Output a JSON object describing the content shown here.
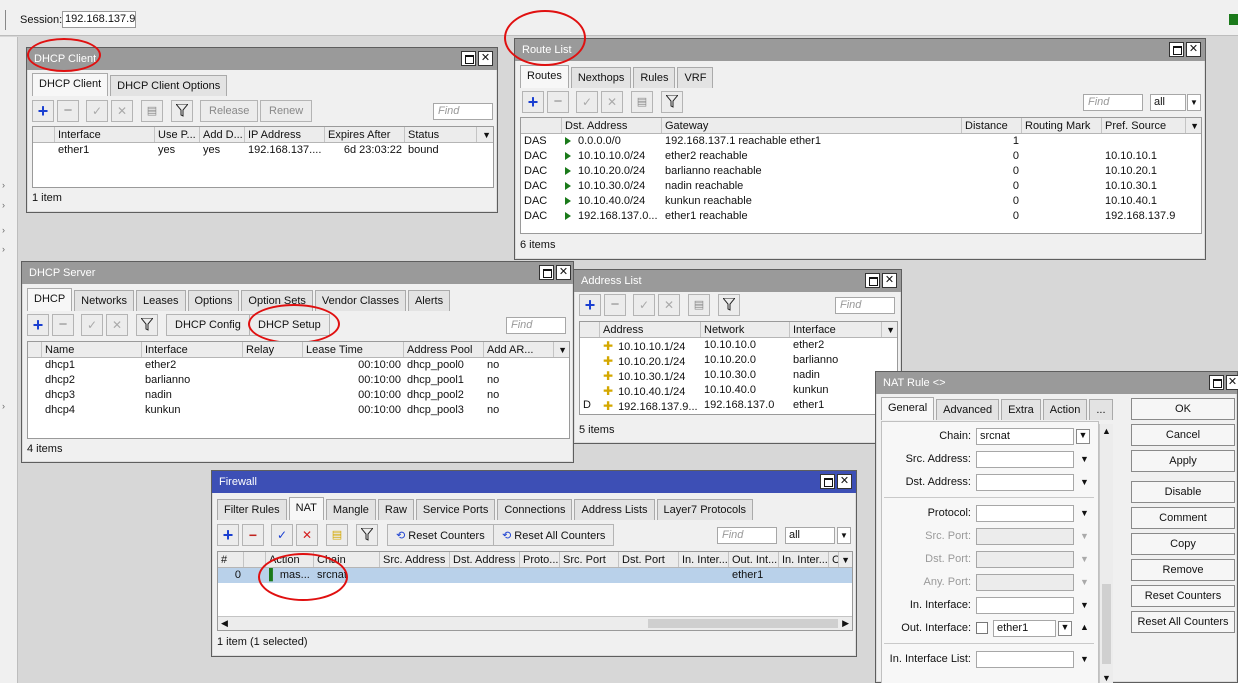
{
  "session": {
    "label": "Session:",
    "value": "192.168.137.9"
  },
  "common": {
    "find": "Find",
    "all": "all"
  },
  "dhcp_client": {
    "title": "DHCP Client",
    "tabs": [
      "DHCP Client",
      "DHCP Client Options"
    ],
    "buttons": {
      "release": "Release",
      "renew": "Renew"
    },
    "columns": [
      "Interface",
      "Use P...",
      "Add D...",
      "IP Address",
      "Expires After",
      "Status"
    ],
    "rows": [
      [
        "ether1",
        "yes",
        "yes",
        "192.168.137....",
        "6d 23:03:22",
        "bound"
      ]
    ],
    "status": "1 item"
  },
  "route_list": {
    "title": "Route List",
    "tabs": [
      "Routes",
      "Nexthops",
      "Rules",
      "VRF"
    ],
    "columns": [
      "Dst. Address",
      "Gateway",
      "Distance",
      "Routing Mark",
      "Pref. Source"
    ],
    "rows": [
      {
        "flag": "DAS",
        "dst": "0.0.0.0/0",
        "gateway": "192.168.137.1 reachable ether1",
        "distance": "1",
        "mark": "",
        "pref": ""
      },
      {
        "flag": "DAC",
        "dst": "10.10.10.0/24",
        "gateway": "ether2 reachable",
        "distance": "0",
        "mark": "",
        "pref": "10.10.10.1"
      },
      {
        "flag": "DAC",
        "dst": "10.10.20.0/24",
        "gateway": "barlianno reachable",
        "distance": "0",
        "mark": "",
        "pref": "10.10.20.1"
      },
      {
        "flag": "DAC",
        "dst": "10.10.30.0/24",
        "gateway": "nadin reachable",
        "distance": "0",
        "mark": "",
        "pref": "10.10.30.1"
      },
      {
        "flag": "DAC",
        "dst": "10.10.40.0/24",
        "gateway": "kunkun reachable",
        "distance": "0",
        "mark": "",
        "pref": "10.10.40.1"
      },
      {
        "flag": "DAC",
        "dst": "192.168.137.0...",
        "gateway": "ether1 reachable",
        "distance": "0",
        "mark": "",
        "pref": "192.168.137.9"
      }
    ],
    "status": "6 items"
  },
  "dhcp_server": {
    "title": "DHCP Server",
    "tabs": [
      "DHCP",
      "Networks",
      "Leases",
      "Options",
      "Option Sets",
      "Vendor Classes",
      "Alerts"
    ],
    "buttons": {
      "config": "DHCP Config",
      "setup": "DHCP Setup"
    },
    "columns": [
      "Name",
      "Interface",
      "Relay",
      "Lease Time",
      "Address Pool",
      "Add AR..."
    ],
    "rows": [
      [
        "dhcp1",
        "ether2",
        "",
        "00:10:00",
        "dhcp_pool0",
        "no"
      ],
      [
        "dhcp2",
        "barlianno",
        "",
        "00:10:00",
        "dhcp_pool1",
        "no"
      ],
      [
        "dhcp3",
        "nadin",
        "",
        "00:10:00",
        "dhcp_pool2",
        "no"
      ],
      [
        "dhcp4",
        "kunkun",
        "",
        "00:10:00",
        "dhcp_pool3",
        "no"
      ]
    ],
    "status": "4 items"
  },
  "address_list": {
    "title": "Address List",
    "columns": [
      "Address",
      "Network",
      "Interface"
    ],
    "rows": [
      {
        "flag": "",
        "address": "10.10.10.1/24",
        "network": "10.10.10.0",
        "interface": "ether2"
      },
      {
        "flag": "",
        "address": "10.10.20.1/24",
        "network": "10.10.20.0",
        "interface": "barlianno"
      },
      {
        "flag": "",
        "address": "10.10.30.1/24",
        "network": "10.10.30.0",
        "interface": "nadin"
      },
      {
        "flag": "",
        "address": "10.10.40.1/24",
        "network": "10.10.40.0",
        "interface": "kunkun"
      },
      {
        "flag": "D",
        "address": "192.168.137.9...",
        "network": "192.168.137.0",
        "interface": "ether1"
      }
    ],
    "status": "5 items"
  },
  "firewall": {
    "title": "Firewall",
    "tabs": [
      "Filter Rules",
      "NAT",
      "Mangle",
      "Raw",
      "Service Ports",
      "Connections",
      "Address Lists",
      "Layer7 Protocols"
    ],
    "buttons": {
      "reset": "Reset Counters",
      "reset_all": "Reset All Counters"
    },
    "columns": [
      "#",
      "Action",
      "Chain",
      "Src. Address",
      "Dst. Address",
      "Proto...",
      "Src. Port",
      "Dst. Port",
      "In. Inter...",
      "Out. Int...",
      "In. Inter...",
      "C"
    ],
    "rows": [
      {
        "num": "0",
        "action": "mas...",
        "chain": "srcnat",
        "out": "ether1"
      }
    ],
    "status": "1 item (1 selected)"
  },
  "nat_rule": {
    "title": "NAT Rule <>",
    "tabs": [
      "General",
      "Advanced",
      "Extra",
      "Action",
      "..."
    ],
    "fields": {
      "chain": {
        "label": "Chain:",
        "value": "srcnat"
      },
      "src_address": {
        "label": "Src. Address:"
      },
      "dst_address": {
        "label": "Dst. Address:"
      },
      "protocol": {
        "label": "Protocol:"
      },
      "src_port": {
        "label": "Src. Port:"
      },
      "dst_port": {
        "label": "Dst. Port:"
      },
      "any_port": {
        "label": "Any. Port:"
      },
      "in_interface": {
        "label": "In. Interface:"
      },
      "out_interface": {
        "label": "Out. Interface:",
        "value": "ether1"
      },
      "in_interface_list": {
        "label": "In. Interface List:"
      }
    },
    "buttons": [
      "OK",
      "Cancel",
      "Apply",
      "Disable",
      "Comment",
      "Copy",
      "Remove",
      "Reset Counters",
      "Reset All Counters"
    ]
  }
}
